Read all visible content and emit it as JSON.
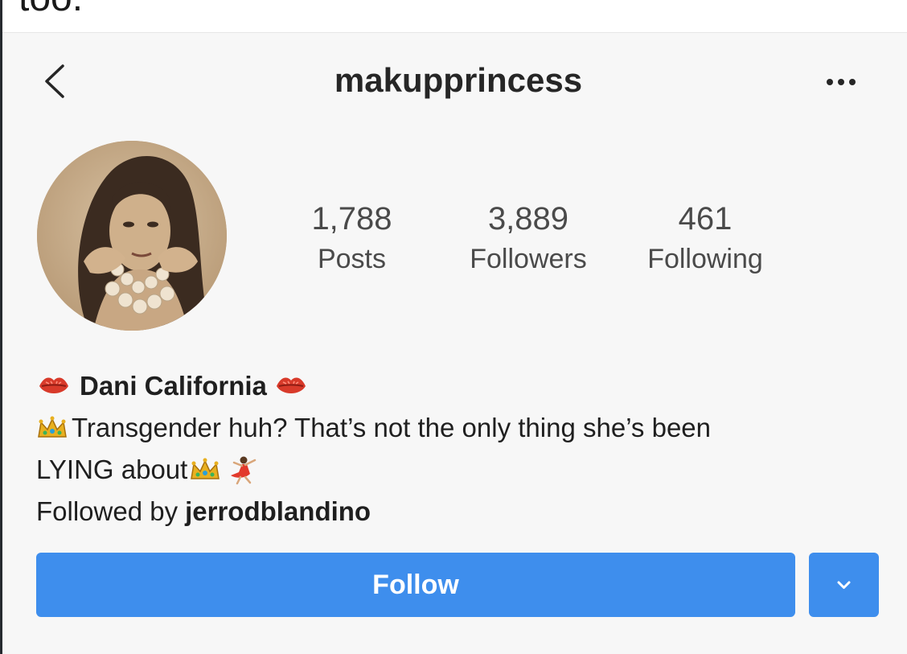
{
  "top_crop_text": "too.",
  "header": {
    "username": "makupprincess",
    "back_icon": "chevron-left-icon",
    "more_icon": "more-horizontal-icon"
  },
  "stats": {
    "posts": {
      "value": "1,788",
      "label": "Posts"
    },
    "followers": {
      "value": "3,889",
      "label": "Followers"
    },
    "following": {
      "value": "461",
      "label": "Following"
    }
  },
  "bio": {
    "name": "Dani California",
    "line1": "Transgender huh? That’s not the only thing she’s been",
    "line2": "LYING about",
    "followed_by_prefix": "Followed by",
    "followed_by_user": "jerrodblandino"
  },
  "actions": {
    "follow_label": "Follow",
    "dropdown_icon": "chevron-down-icon"
  },
  "colors": {
    "accent": "#3e8eed",
    "background": "#f7f7f7",
    "text": "#262626"
  }
}
